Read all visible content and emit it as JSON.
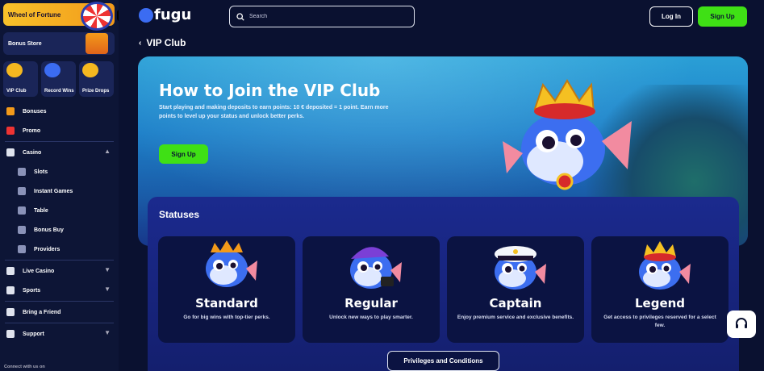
{
  "sidebar": {
    "wheel_label": "Wheel of Fortune",
    "bonus_store_label": "Bonus Store",
    "tiles": [
      {
        "label": "VIP Club",
        "icon": "crown-icon",
        "color": "#f5b820"
      },
      {
        "label": "Record Wins",
        "icon": "trophy-icon",
        "color": "#3b6cf2"
      },
      {
        "label": "Prize Drops",
        "icon": "coin-icon",
        "color": "#f5b820"
      }
    ],
    "nav_top": [
      {
        "label": "Bonuses",
        "icon": "gift-icon",
        "color": "#f39a1a"
      },
      {
        "label": "Promo",
        "icon": "megaphone-icon",
        "color": "#e33"
      }
    ],
    "casino_label": "Casino",
    "casino_sub": [
      {
        "label": "Slots"
      },
      {
        "label": "Instant Games"
      },
      {
        "label": "Table"
      },
      {
        "label": "Bonus Buy"
      },
      {
        "label": "Providers"
      }
    ],
    "live_casino_label": "Live Casino",
    "sports_label": "Sports",
    "bring_friend_label": "Bring a Friend",
    "support_label": "Support",
    "connect_label": "Connect with us on"
  },
  "header": {
    "logo_text": "fugu",
    "search_placeholder": "Search",
    "login_label": "Log In",
    "signup_label": "Sign Up"
  },
  "page": {
    "breadcrumb": "VIP Club",
    "hero_title": "How to Join the VIP Club",
    "hero_text": "Start playing and making deposits to earn points: 10 € deposited = 1 point. Earn more points to level up your status and unlock better perks.",
    "hero_button": "Sign Up",
    "statuses_title": "Statuses",
    "statuses": [
      {
        "name": "Standard",
        "desc": "Go for big wins with top-tier perks."
      },
      {
        "name": "Regular",
        "desc": "Unlock new ways to play smarter."
      },
      {
        "name": "Captain",
        "desc": "Enjoy premium service and exclusive benefits."
      },
      {
        "name": "Legend",
        "desc": "Get access to privileges reserved for a select few."
      }
    ],
    "privileges_button": "Privileges and Conditions"
  },
  "colors": {
    "accent_green": "#3fe015",
    "bg_dark": "#0a1130",
    "sidebar_bg": "#0d1536"
  }
}
